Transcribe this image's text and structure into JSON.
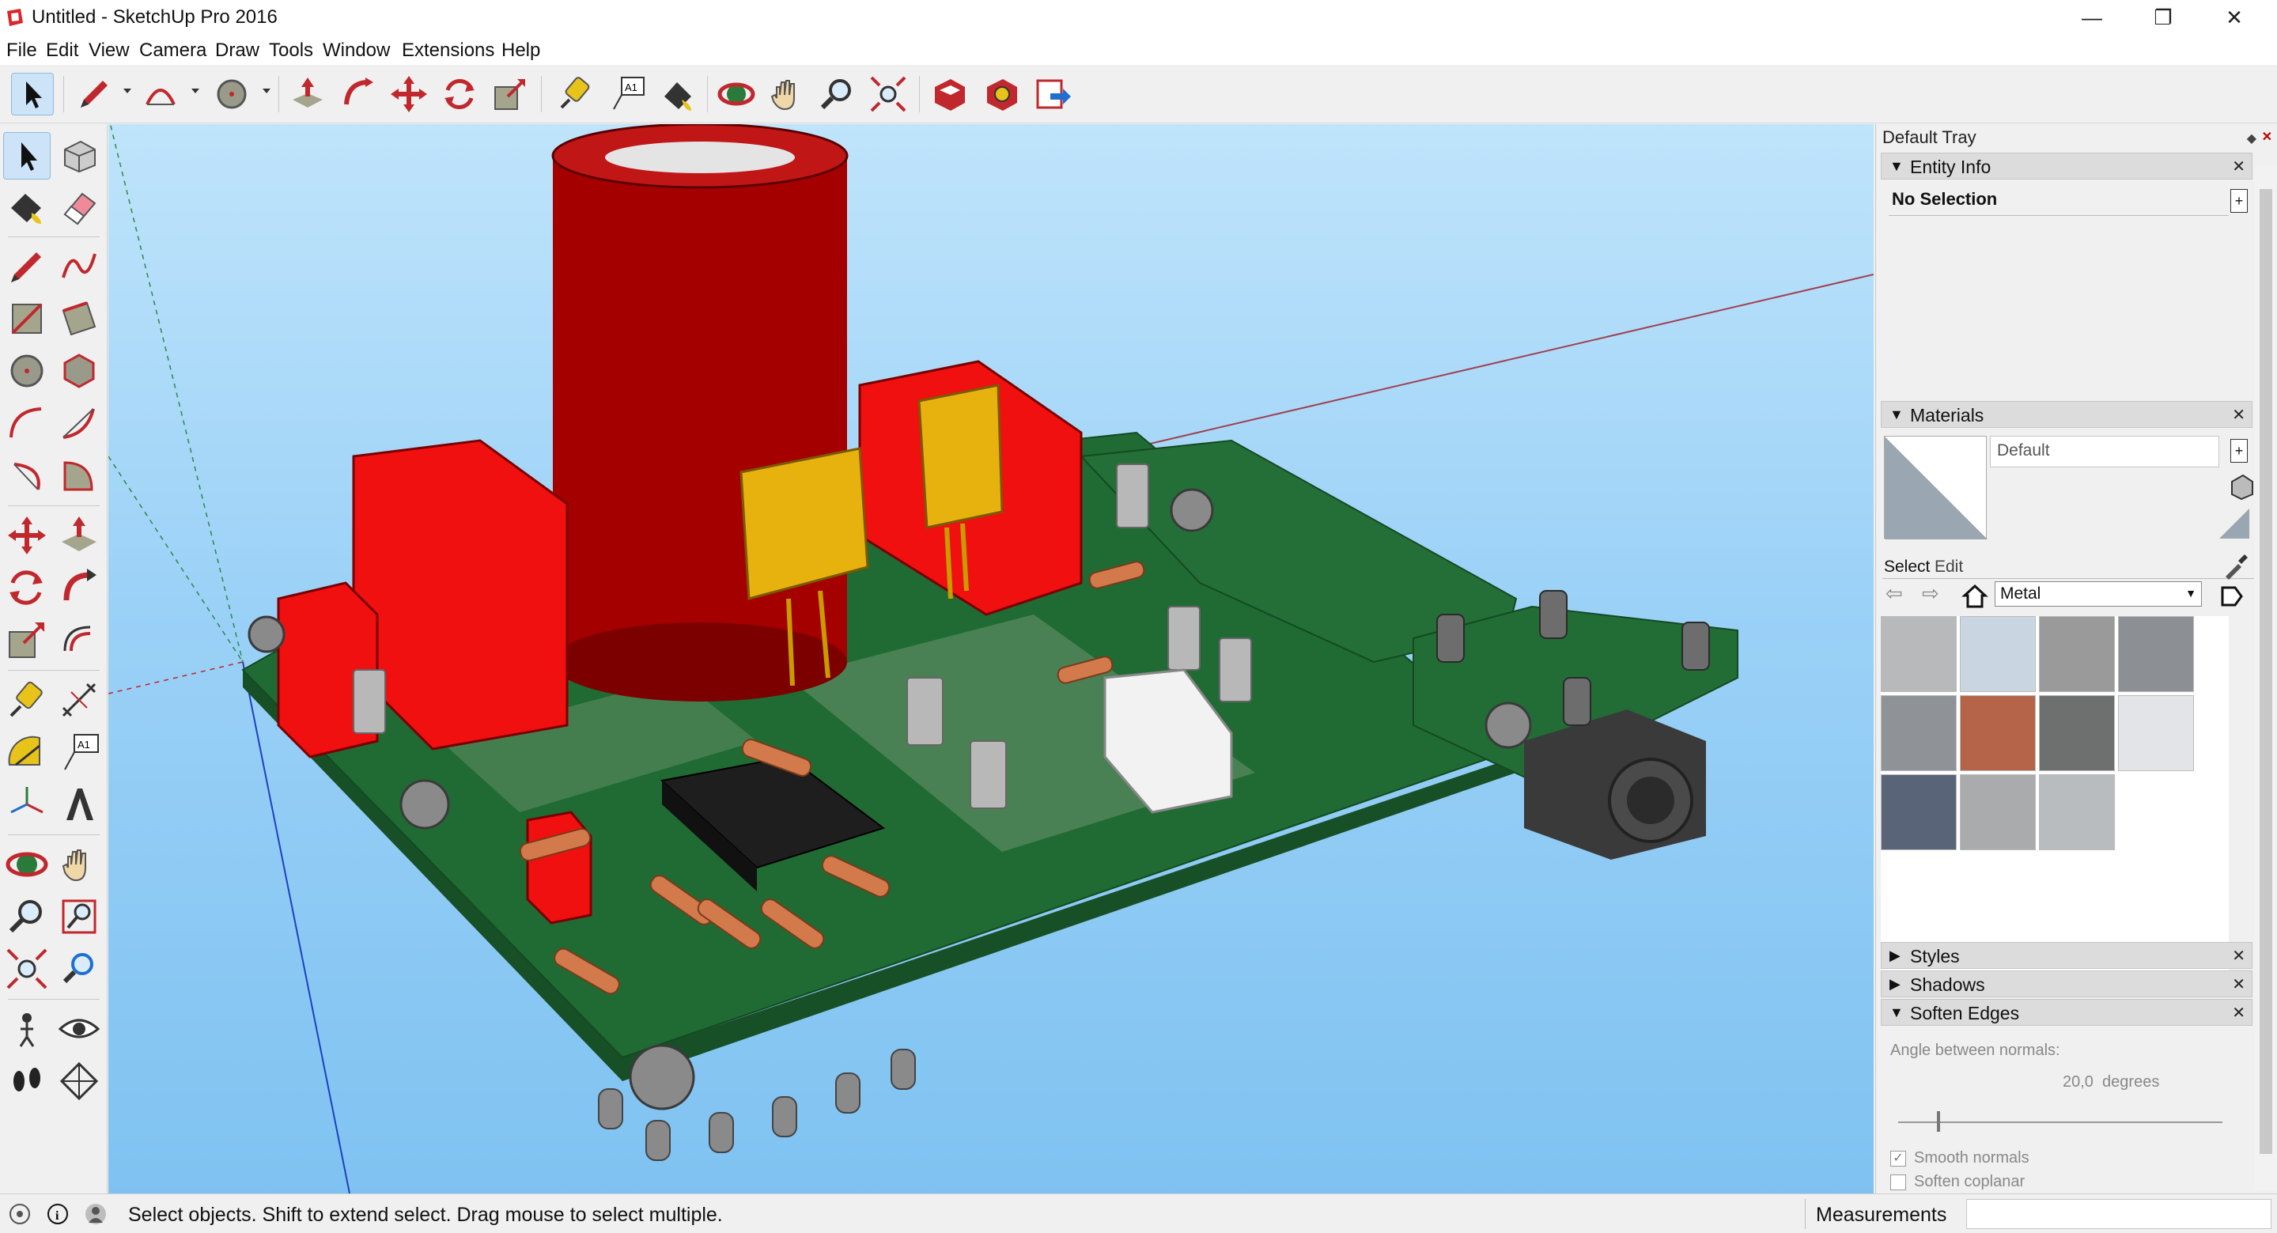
{
  "window": {
    "title": "Untitled - SketchUp Pro 2016",
    "minimize": "—",
    "restore": "❐",
    "close": "✕"
  },
  "menu": [
    "File",
    "Edit",
    "View",
    "Camera",
    "Draw",
    "Tools",
    "Window",
    "Extensions",
    "Help"
  ],
  "toolbar_icons": [
    "select-icon",
    "pencil-icon",
    "arc-icon",
    "circle-icon",
    "push-pull-icon",
    "follow-me-icon",
    "move-icon",
    "rotate-icon",
    "scale-icon",
    "tape-measure-icon",
    "text-icon",
    "paint-bucket-icon",
    "orbit-icon",
    "pan-icon",
    "zoom-icon",
    "zoom-extents-icon",
    "3d-warehouse-icon",
    "extension-warehouse-icon",
    "send-to-layout-icon"
  ],
  "tray": {
    "title": "Default Tray",
    "entity_info": {
      "label": "Entity Info",
      "selection": "No Selection"
    },
    "materials": {
      "label": "Materials",
      "current": "Default",
      "tab_select": "Select",
      "tab_edit": "Edit",
      "library": "Metal",
      "swatches": [
        "#b7b9bb",
        "#c9d6e2",
        "#9a9a9a",
        "#8c8f93",
        "#8f9398",
        "#b5644a",
        "#6e7070",
        "#e3e4e8",
        "#5a6478",
        "#a9abad",
        "#b8bcbf"
      ]
    },
    "styles": {
      "label": "Styles"
    },
    "shadows": {
      "label": "Shadows"
    },
    "soften_edges": {
      "label": "Soften Edges",
      "angle_label": "Angle between normals:",
      "angle_value": "20,0  degrees",
      "slider_value": 0.12,
      "smooth_normals": "Smooth normals",
      "soften_coplanar": "Soften coplanar"
    }
  },
  "status": {
    "hint": "Select objects. Shift to extend select. Drag mouse to select multiple.",
    "measurements_label": "Measurements",
    "measurements_value": ""
  },
  "colors": {
    "pcb": "#1f6b33",
    "capacitor": "#b30000",
    "viewport_sky": "#9bd1f7",
    "accent": "#cde3f7"
  }
}
